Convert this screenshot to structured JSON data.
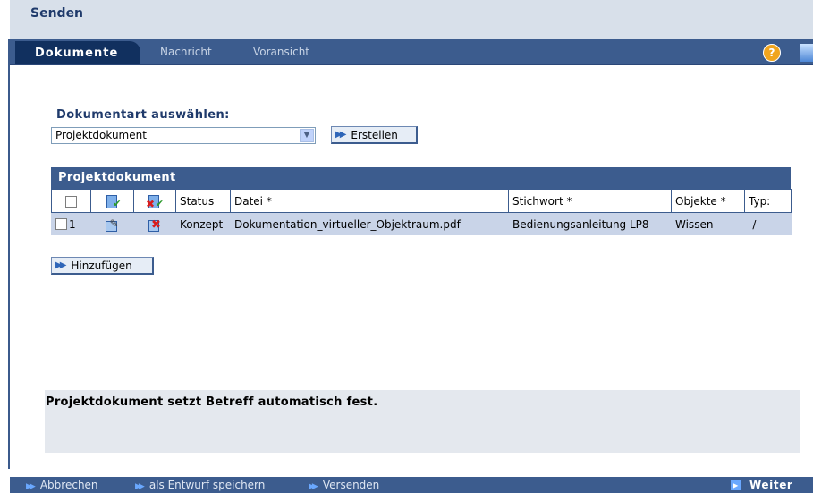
{
  "window": {
    "title": "Senden"
  },
  "tabs": {
    "active": "Dokumente",
    "others": [
      "Nachricht",
      "Voransicht"
    ]
  },
  "header_icons": {
    "help": "help-icon",
    "help_glyph": "?",
    "flag": "flag-icon"
  },
  "form": {
    "doc_type_label": "Dokumentart auswählen:",
    "doc_type_selected": "Projektdokument",
    "create_button": "Erstellen"
  },
  "documents_panel": {
    "title": "Projektdokument",
    "columns": [
      "Status",
      "Datei *",
      "Stichwort *",
      "Objekte *",
      "Typ:"
    ],
    "rows": [
      {
        "num": "1",
        "status": "Konzept",
        "file": "Dokumentation_virtueller_Objektraum.pdf",
        "keyword": "Bedienungsanleitung LP8",
        "objects": "Wissen",
        "type": "-/-"
      }
    ],
    "add_button": "Hinzufügen"
  },
  "info_text": "Projektdokument setzt Betreff automatisch fest.",
  "footer": {
    "cancel": "Abbrechen",
    "save_draft": "als Entwurf speichern",
    "send": "Versenden",
    "next": "Weiter"
  }
}
